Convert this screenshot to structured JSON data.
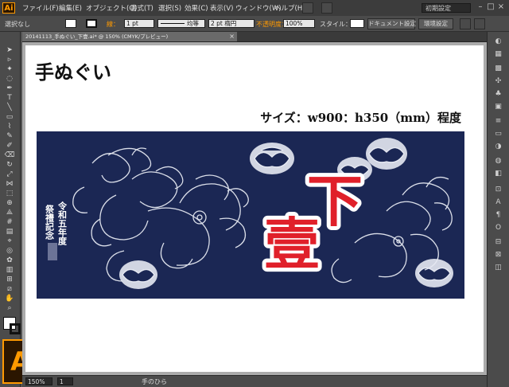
{
  "app": {
    "logo_text": "Ai"
  },
  "menu": [
    "ファイル(F)",
    "編集(E)",
    "オブジェクト(O)",
    "書式(T)",
    "選択(S)",
    "効果(C)",
    "表示(V)",
    "ウィンドウ(W)",
    "ヘルプ(H)"
  ],
  "workspace": "初期設定",
  "control_bar": {
    "selection": "選択なし",
    "stroke_label": "線：",
    "stroke_weight": "1 pt",
    "stroke_profile": "均等",
    "brush": "2 pt 楕円",
    "opacity_label": "不透明度：",
    "opacity": "100%",
    "style_label": "スタイル：",
    "document_settings": "ドキュメント設定",
    "preferences": "環境設定"
  },
  "document_tab": {
    "name": "20141113_手ぬぐい_下壹.ai* @ 150% (CMYK/プレビュー)",
    "close": "×"
  },
  "artboard": {
    "title": "手ぬぐい",
    "size_text": "サイズ：w900：h350（mm）程度"
  },
  "towel": {
    "big_chars": [
      "下",
      "壹"
    ],
    "vertical_text_1": "令和五年度",
    "vertical_text_2": "祭禮記念"
  },
  "status": {
    "zoom": "150%",
    "page": "1",
    "tool": "手のひら"
  },
  "colors": {
    "towel_navy": "#1b2754",
    "red_text": "#e0202a",
    "ai_orange": "#ff9a00"
  }
}
